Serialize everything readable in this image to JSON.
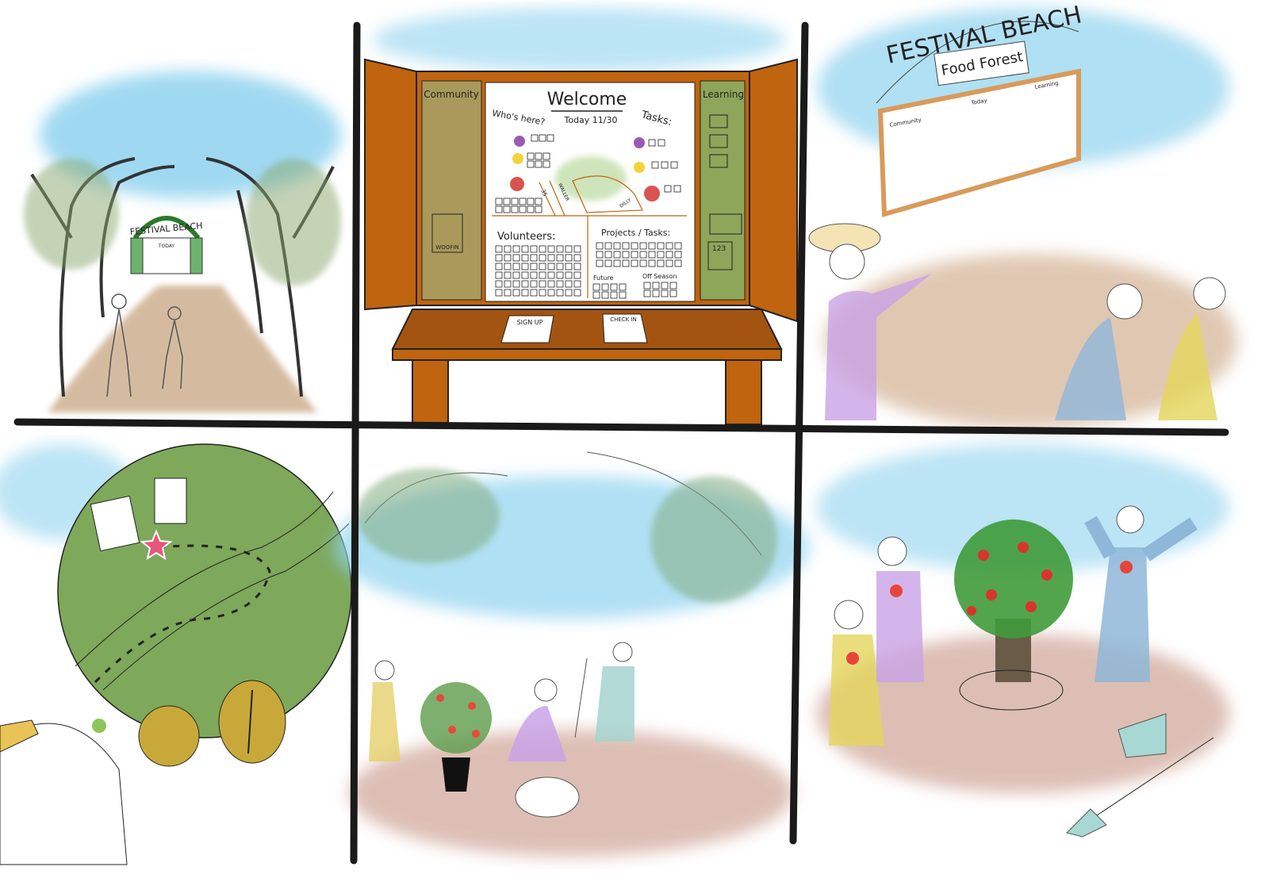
{
  "panel_1": {
    "arch_sign": "FESTIVAL BEACH",
    "board_label": "TODAY"
  },
  "panel_2": {
    "community_label": "Community",
    "learning_label": "Learning",
    "welcome_title": "Welcome",
    "today_date": "Today 11/30",
    "whos_here_label": "Who's here?",
    "tasks_label": "Tasks:",
    "map_labels": [
      "35",
      "WALLER",
      "DILLY"
    ],
    "dog_poster_label": "WOOFIN",
    "learning_card_label": "123",
    "volunteers_label": "Volunteers:",
    "projects_label": "Projects / Tasks:",
    "future_label": "Future",
    "off_season_label": "Off Season",
    "signup_sheet": "SIGN UP",
    "checkin_sheet": "CHECK IN"
  },
  "panel_3": {
    "arch_sign": "FESTIVAL BEACH",
    "sub_sign": "Food Forest",
    "board_sections": [
      "Community",
      "Today",
      "Learning"
    ]
  },
  "colors": {
    "board_wood": "#c0640f",
    "board_dark": "#8a4a12",
    "community_panel": "#a99a5c",
    "learning_panel": "#8ea65a",
    "sky": "#8fd3ef",
    "map_green": "#7ea85a",
    "tool_gold": "#c9a83a",
    "grid_line": "#1a1a1a"
  }
}
